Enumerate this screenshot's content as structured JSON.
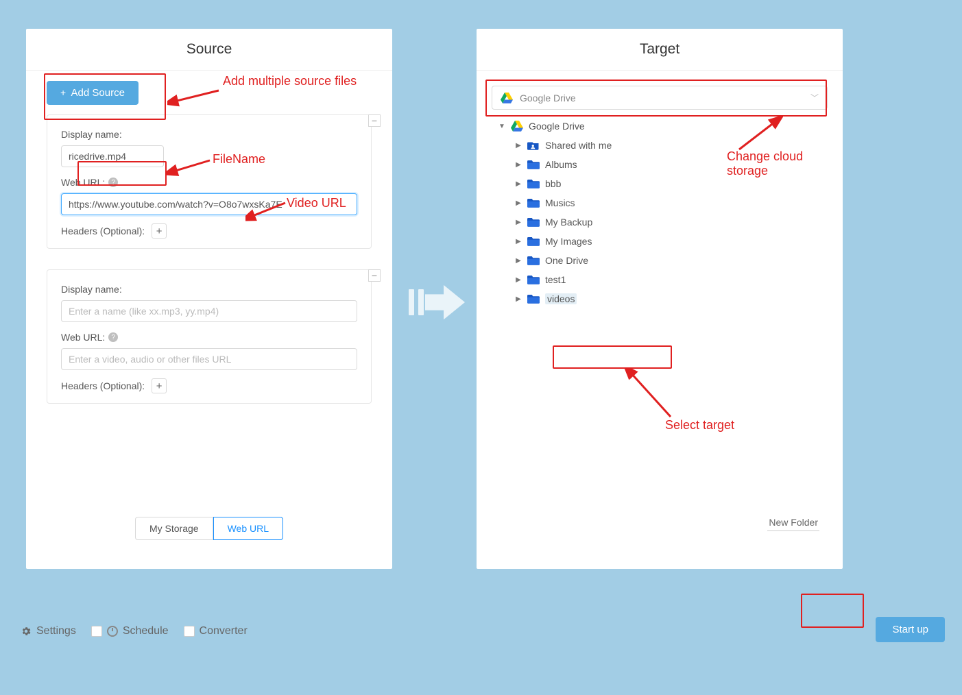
{
  "source": {
    "title": "Source",
    "add_button": "Add Source",
    "cards": [
      {
        "display_label": "Display name:",
        "filename": "ricedrive.mp4",
        "url_label": "Web URL:",
        "url_value": "https://www.youtube.com/watch?v=O8o7wxsKa7E",
        "headers_label": "Headers (Optional):"
      },
      {
        "display_label": "Display name:",
        "display_placeholder": "Enter a name (like xx.mp3, yy.mp4)",
        "url_label": "Web URL:",
        "url_placeholder": "Enter a video, audio or other files URL",
        "headers_label": "Headers (Optional):"
      }
    ],
    "tabs": {
      "left": "My Storage",
      "right": "Web URL"
    }
  },
  "target": {
    "title": "Target",
    "selected_service": "Google Drive",
    "root": "Google Drive",
    "folders": [
      "Shared with me",
      "Albums",
      "bbb",
      "Musics",
      "My Backup",
      "My Images",
      "One Drive",
      "test1",
      "videos"
    ],
    "new_folder": "New Folder"
  },
  "footer": {
    "settings": "Settings",
    "schedule": "Schedule",
    "converter": "Converter",
    "start": "Start up"
  },
  "annotations": {
    "add_files": "Add multiple source files",
    "filename": "FileName",
    "video_url": "Video URL",
    "change_cloud": "Change cloud storage",
    "select_target": "Select target"
  }
}
